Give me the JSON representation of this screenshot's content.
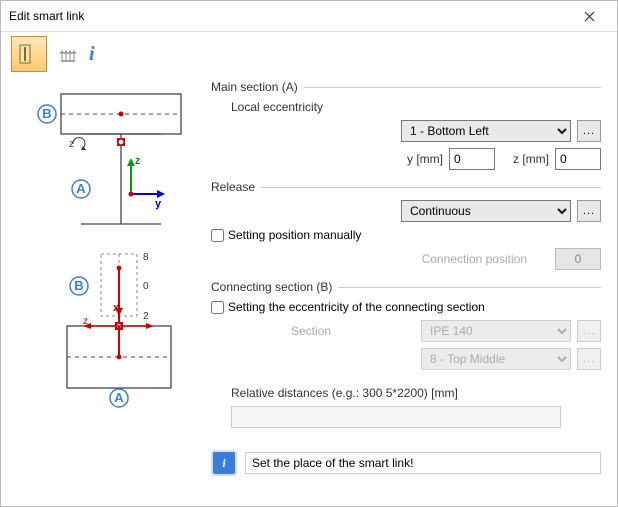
{
  "window": {
    "title": "Edit smart link"
  },
  "main_section": {
    "header": "Main section (A)",
    "local_eccentricity_label": "Local eccentricity",
    "eccentricity_combo": "1 - Bottom Left",
    "y_label": "y [mm]",
    "y_value": "0",
    "z_label": "z [mm]",
    "z_value": "0"
  },
  "release": {
    "header": "Release",
    "combo": "Continuous",
    "setting_position_label": "Setting position manually",
    "connection_position_label": "Connection position",
    "connection_position_value": "0"
  },
  "connecting_section": {
    "header": "Connecting section (B)",
    "setting_ecc_label": "Setting the eccentricity of the connecting section",
    "section_label": "Section",
    "section_combo": "IPE 140",
    "position_combo": "8 - Top Middle"
  },
  "relative": {
    "label": "Relative distances (e.g.: 300 5*2200) [mm]"
  },
  "status": {
    "text": "Set the place of the smart link!"
  },
  "ui": {
    "dots": "..."
  }
}
